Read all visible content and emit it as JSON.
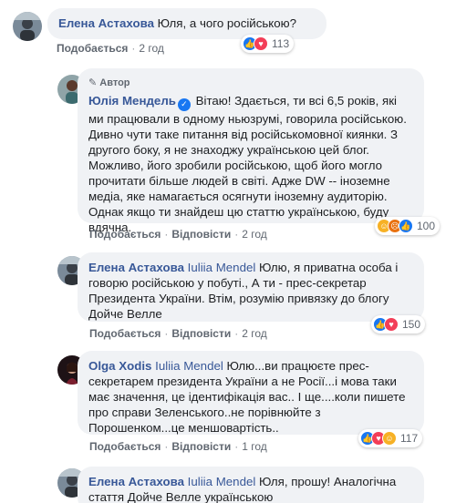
{
  "comments": [
    {
      "author": "Елена Астахова",
      "tag": "",
      "text": "Юля, а чого російською?",
      "like_label": "Подобається",
      "time": "2 год",
      "reaction_count": "113"
    },
    {
      "author_badge": "Автор",
      "author": "Юлія Мендель",
      "text": "Вітаю! Здається, ти всі 6,5 років, які ми працювали в одному ньюзрумі, говорила російською. Дивно чути таке питання від російськомовної киянки. З другого боку, я не знаходжу українською цей блог. Можливо, його зробили російською, щоб його могло прочитати більше людей в світі. Адже DW -- іноземне медіа, яке намагається осягнути іноземну аудиторію. Однак якщо ти знайдеш цю статтю українською, буду вдячна.",
      "like_label": "Подобається",
      "reply_label": "Відповісти",
      "time": "2 год",
      "reaction_count": "100"
    },
    {
      "author": "Елена Астахова",
      "tag": "Iuliia Mendel",
      "text": "Юлю, я приватна особа і говорю російською у побуті., А ти - прес-секретар Президента України. Втім, розумію привязку до блогу Дойче Велле",
      "like_label": "Подобається",
      "reply_label": "Відповісти",
      "time": "2 год",
      "reaction_count": "150"
    },
    {
      "author": "Olga Xodis",
      "tag": "Iuliia Mendel",
      "text": "Юлю...ви працюєте прес-секретарем президента України а не Росії...і мова таки має значення, це ідентифікація вас.. І ще....коли пишете про справи Зеленського..не порівнюйте з Порошенком...це меншовартість..",
      "like_label": "Подобається",
      "reply_label": "Відповісти",
      "time": "1 год",
      "reaction_count": "117"
    },
    {
      "author": "Елена Астахова",
      "tag": "Iuliia Mendel",
      "text": "Юля, прошу! Аналогічна стаття Дойче Велле українською"
    }
  ],
  "colors": {
    "link": "#385898",
    "bubble": "#f0f2f5",
    "meta": "#606770",
    "like": "#1877f2",
    "love": "#f33e58"
  }
}
